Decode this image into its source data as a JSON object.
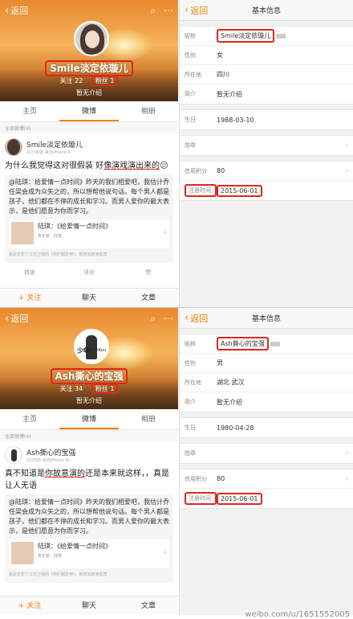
{
  "top": {
    "left": {
      "back": "返回",
      "name": "Smile淡定依璇儿",
      "follow_label": "关注",
      "follow_count": "22",
      "fans_label": "粉丝",
      "fans_count": "1",
      "intro": "暂无介绍",
      "tabs": [
        "主页",
        "微博",
        "相册"
      ],
      "filter": "全部微博(4)",
      "post_author": "Smile淡定依璇儿",
      "post_time": "10分钟前 来自iPhone 6",
      "post_text_a": "为什么我觉得这对很假装 好",
      "post_text_u": "像演戏演出来的",
      "post_text_b": "😕",
      "repost_text": "@陆琪：给爱情一点时间》昨天的我们相爱吧，我估计乔任梁会成为众矢之的，所以想帮他说句话。每个男人都是孩子，他们都在不停的成长和学习。而男人爱你的最大表示，是他们愿意为你而学习。",
      "card_title": "陆琪：《给爱情一点时间》",
      "card_sub": "发布者：陆琪",
      "card_hint": "最近去爱了江苏卫视的《我们相爱吧》，新增加的演嘉宾",
      "actions": [
        "转发",
        "评论",
        "赞"
      ],
      "bottom": [
        "+ 关注",
        "聊天",
        "文章"
      ]
    },
    "right": {
      "back": "返回",
      "title": "基本信息",
      "rows": [
        {
          "label": "昵称",
          "value": "Smile淡定依璇儿"
        },
        {
          "label": "性别",
          "value": "女"
        },
        {
          "label": "所在地",
          "value": "四川"
        },
        {
          "label": "简介",
          "value": "暂无介绍"
        }
      ],
      "birthday_label": "生日",
      "birthday": "1988-03-10",
      "badge_label": "勋章",
      "credit_label": "信用积分",
      "credit": "80",
      "reg_label": "注册时间",
      "reg": "2015-06-01"
    }
  },
  "bottom": {
    "left": {
      "back": "返回",
      "avatar_text_a": "少年",
      "avatar_text_b": "ShiNianKou",
      "name": "Ash撕心的宝强",
      "follow_label": "关注",
      "follow_count": "34",
      "fans_label": "粉丝",
      "fans_count": "1",
      "intro": "暂无介绍",
      "tabs": [
        "主页",
        "微博",
        "相册"
      ],
      "filter": "全部微博(4)",
      "post_author": "Ash撕心的宝强",
      "post_time": "2小时前 来自iPhone 6s",
      "post_text_a": "真不知道是",
      "post_text_u": "你故意演的",
      "post_text_b": "还是本来就这样，，真是让人无语",
      "repost_text": "@陆琪：给爱情一点时间》昨天的我们相爱吧，我估计乔任梁会成为众矢之的，所以想帮他说句话。每个男人都是孩子，他们都在不停的成长和学习。而男人爱你的最大表示，是他们愿意为你而学习。",
      "card_title": "陆琪：《给爱情一点时间》",
      "card_sub": "发布者：陆琪",
      "card_hint": "最近去爱了江苏卫视的《我们相爱吧》，新增加的演嘉宾",
      "bottom": [
        "+ 关注",
        "聊天",
        "文章"
      ]
    },
    "right": {
      "back": "返回",
      "title": "基本信息",
      "rows": [
        {
          "label": "昵称",
          "value": "Ash撕心的宝强"
        },
        {
          "label": "性别",
          "value": "男"
        },
        {
          "label": "所在地",
          "value": "湖北 武汉"
        },
        {
          "label": "简介",
          "value": "暂无介绍"
        }
      ],
      "birthday_label": "生日",
      "birthday": "1980-04-28",
      "badge_label": "勋章",
      "credit_label": "信用积分",
      "credit": "80",
      "reg_label": "注册时间",
      "reg": "2015-06-01"
    }
  },
  "watermark": "weibo.com/u/1651552005"
}
